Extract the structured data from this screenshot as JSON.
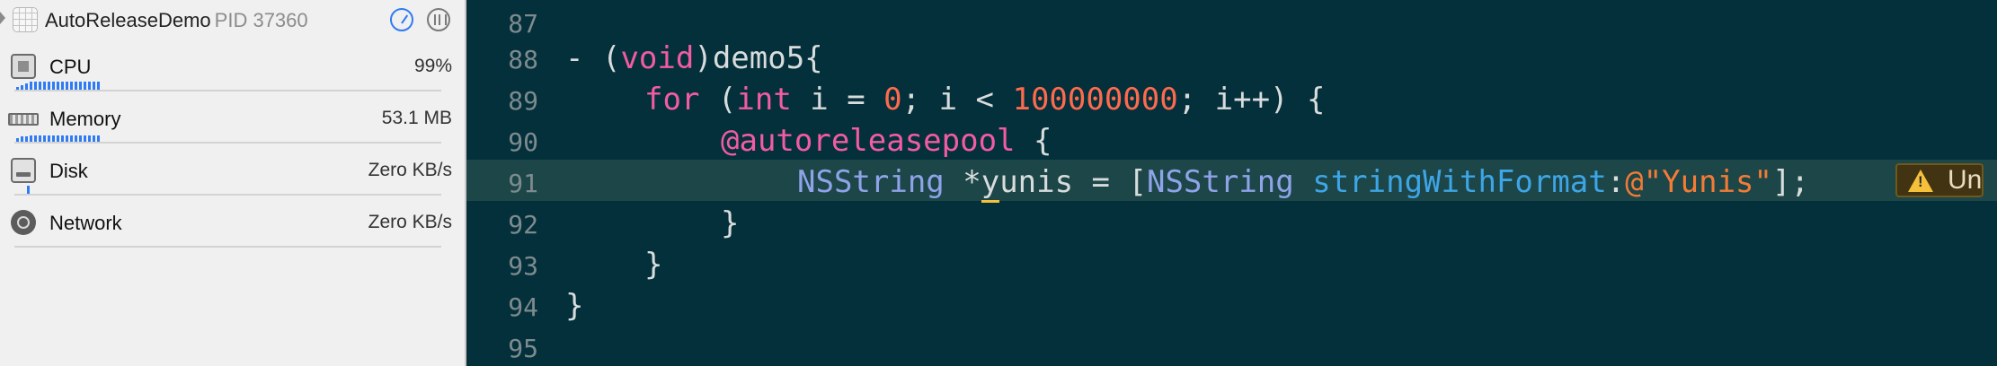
{
  "process": {
    "name": "AutoReleaseDemo",
    "pid": "PID 37360"
  },
  "gauges": [
    {
      "label": "CPU",
      "value": "99%",
      "icon": "cpu-icon"
    },
    {
      "label": "Memory",
      "value": "53.1 MB",
      "icon": "memory-icon"
    },
    {
      "label": "Disk",
      "value": "Zero KB/s",
      "icon": "disk-icon"
    },
    {
      "label": "Network",
      "value": "Zero KB/s",
      "icon": "network-icon"
    }
  ],
  "editor": {
    "line_numbers": [
      "87",
      "88",
      "89",
      "90",
      "91",
      "92",
      "93",
      "94",
      "95"
    ],
    "highlighted_line": "91",
    "code": {
      "l88": {
        "dash": "- ",
        "open": "(",
        "void": "void",
        "close": ")",
        "name": "demo5{"
      },
      "l89": {
        "for": "for",
        "p1": " (",
        "int": "int",
        "p2": " i = ",
        "zero": "0",
        "p3": "; i < ",
        "limit": "100000000",
        "p4": "; i++) {"
      },
      "l90": {
        "pool": "@autoreleasepool",
        "brace": " {"
      },
      "l91": {
        "type": "NSString",
        "p1": " *",
        "y": "y",
        "var": "unis = [",
        "cls": "NSString",
        "sp": " ",
        "method": "stringWithFormat",
        "colon": ":",
        "str": "@\"Yunis\"",
        "end": "];"
      },
      "l92": "}",
      "l93": "}",
      "l94": "}"
    },
    "warning": {
      "text": "Un",
      "icon": "warning-triangle-icon",
      "color": "#f6c13a"
    }
  },
  "colors": {
    "editor_bg": "#04303b",
    "keyword": "#f25ca2",
    "number": "#ff6a4d",
    "class": "#8fa3e8",
    "method": "#3ea5e6",
    "string": "#f47b35",
    "gauge_accent": "#2f7bf5"
  }
}
